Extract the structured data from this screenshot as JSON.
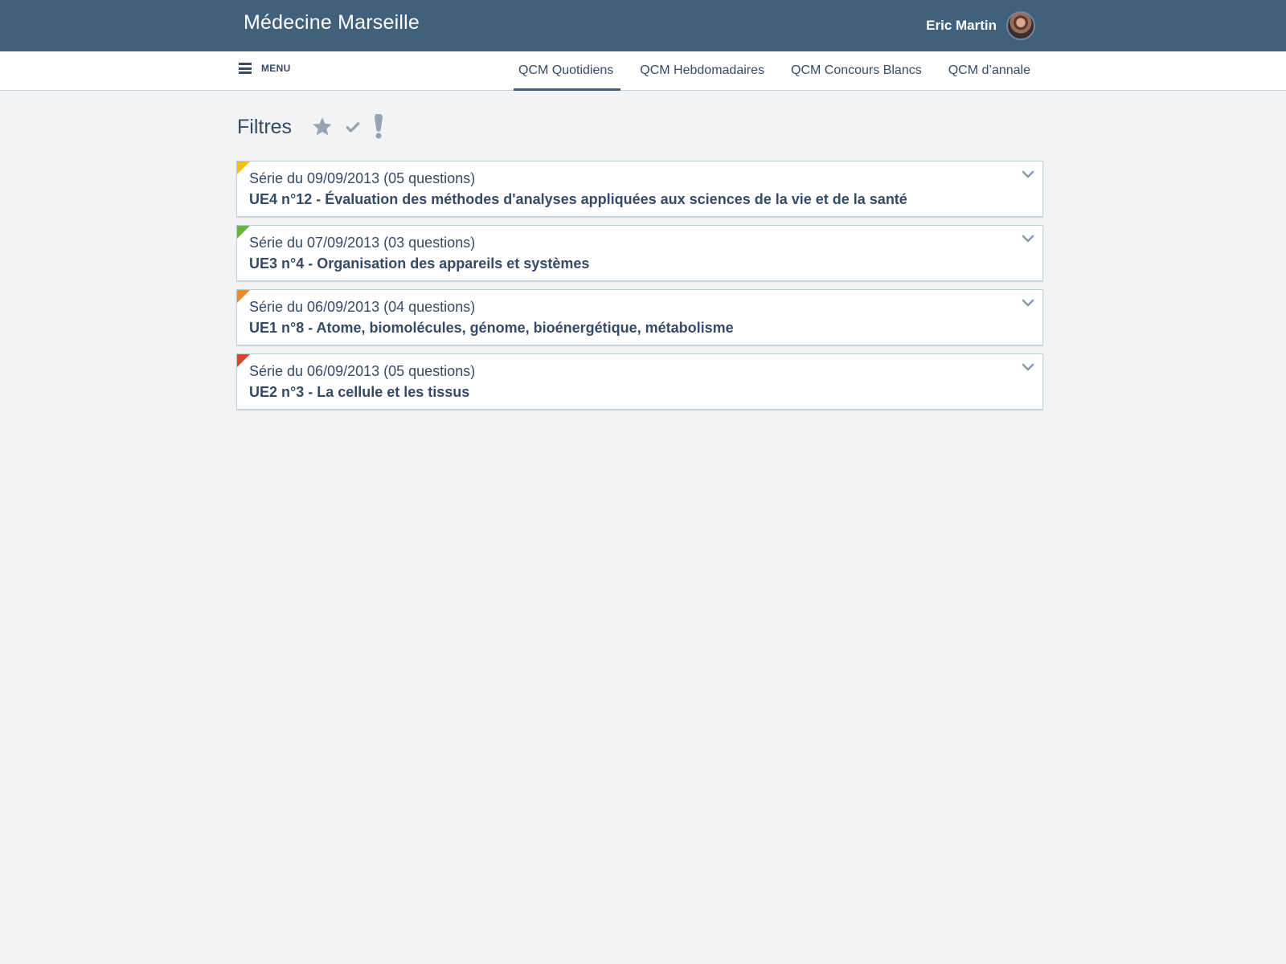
{
  "header": {
    "brand": "Médecine Marseille",
    "user_name": "Eric Martin"
  },
  "nav": {
    "menu_label": "MENU",
    "tabs": [
      {
        "label": "QCM Quotidiens",
        "active": true
      },
      {
        "label": "QCM Hebdomadaires",
        "active": false
      },
      {
        "label": "QCM Concours Blancs",
        "active": false
      },
      {
        "label": "QCM d’annale",
        "active": false
      }
    ]
  },
  "filters": {
    "title": "Filtres",
    "icons": [
      "star-icon",
      "check-icon",
      "exclamation-icon"
    ]
  },
  "series": [
    {
      "subtitle": "Série du 09/09/2013 (05 questions)",
      "title": "UE4 n°12 - Évaluation des méthodes d'analyses appliquées aux sciences de la vie et de la santé",
      "flag_color": "#f5c400"
    },
    {
      "subtitle": "Série du 07/09/2013 (03 questions)",
      "title": "UE3 n°4 - Organisation des appareils et systèmes",
      "flag_color": "#6cb33f"
    },
    {
      "subtitle": "Série du 06/09/2013 (04 questions)",
      "title": "UE1 n°8 - Atome, biomolécules, génome, bioénergétique, métabolisme",
      "flag_color": "#f08a24"
    },
    {
      "subtitle": "Série du 06/09/2013 (05 questions)",
      "title": "UE2 n°3 - La cellule et les tissus",
      "flag_color": "#e0432b"
    }
  ]
}
